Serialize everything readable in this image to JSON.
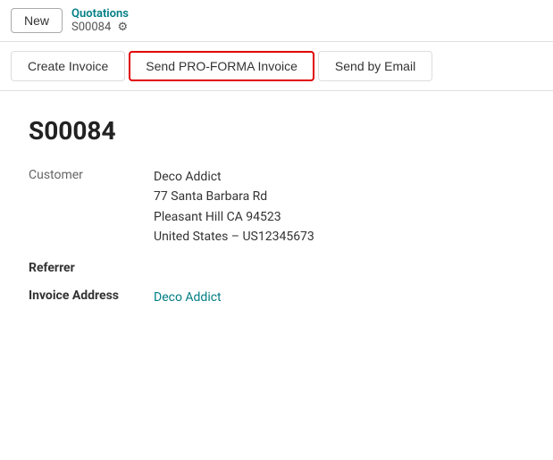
{
  "topbar": {
    "new_label": "New",
    "breadcrumb_title": "Quotations",
    "breadcrumb_sub": "S00084"
  },
  "actions": {
    "create_invoice": "Create Invoice",
    "send_proforma": "Send PRO-FORMA Invoice",
    "send_email": "Send by Email"
  },
  "document": {
    "id": "S00084",
    "customer_label": "Customer",
    "customer_name": "Deco Addict",
    "address_line1": "77 Santa Barbara Rd",
    "address_line2": "Pleasant Hill CA 94523",
    "address_line3": "United States – US12345673",
    "referrer_label": "Referrer",
    "referrer_value": "",
    "invoice_address_label": "Invoice Address",
    "invoice_address_value": "Deco Addict"
  },
  "icons": {
    "gear": "⚙"
  }
}
